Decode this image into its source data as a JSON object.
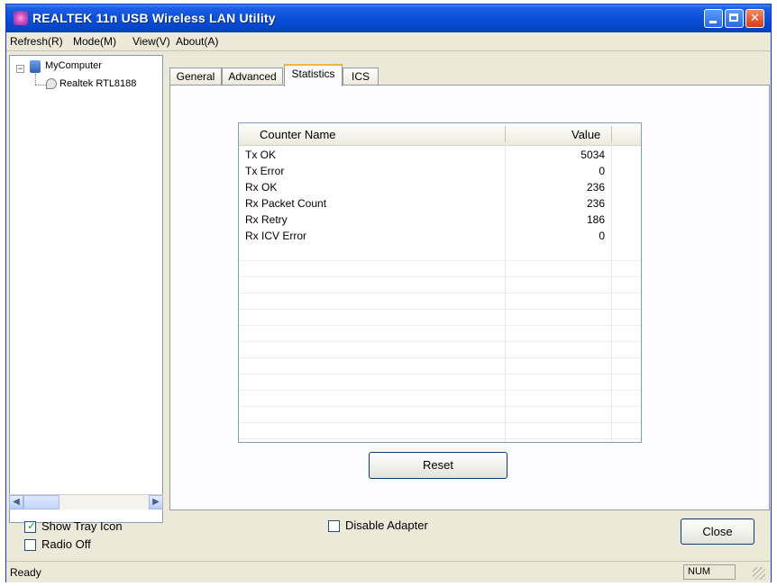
{
  "window": {
    "title": "REALTEK 11n USB Wireless LAN Utility"
  },
  "menu": {
    "items": [
      {
        "label": "Refresh(R)"
      },
      {
        "label": "Mode(M)"
      },
      {
        "label": "View(V)"
      },
      {
        "label": "About(A)"
      }
    ]
  },
  "tree": {
    "root": "MyComputer",
    "child": "Realtek RTL8188"
  },
  "tabs": [
    {
      "label": "General",
      "active": false
    },
    {
      "label": "Advanced",
      "active": false
    },
    {
      "label": "Statistics",
      "active": true
    },
    {
      "label": "ICS",
      "active": false
    }
  ],
  "statistics": {
    "columns": {
      "name": "Counter Name",
      "value": "Value"
    },
    "rows": [
      {
        "name": "Tx OK",
        "value": "5034"
      },
      {
        "name": "Tx Error",
        "value": "0"
      },
      {
        "name": "Rx OK",
        "value": "236"
      },
      {
        "name": "Rx Packet Count",
        "value": "236"
      },
      {
        "name": "Rx Retry",
        "value": "186"
      },
      {
        "name": "Rx ICV Error",
        "value": "0"
      }
    ],
    "reset_label": "Reset"
  },
  "options": {
    "show_tray_icon": {
      "label": "Show Tray Icon",
      "checked": true
    },
    "radio_off": {
      "label": "Radio Off",
      "checked": false
    },
    "disable_adapter": {
      "label": "Disable Adapter",
      "checked": false
    }
  },
  "close_label": "Close",
  "status": {
    "text": "Ready",
    "num": "NUM"
  }
}
